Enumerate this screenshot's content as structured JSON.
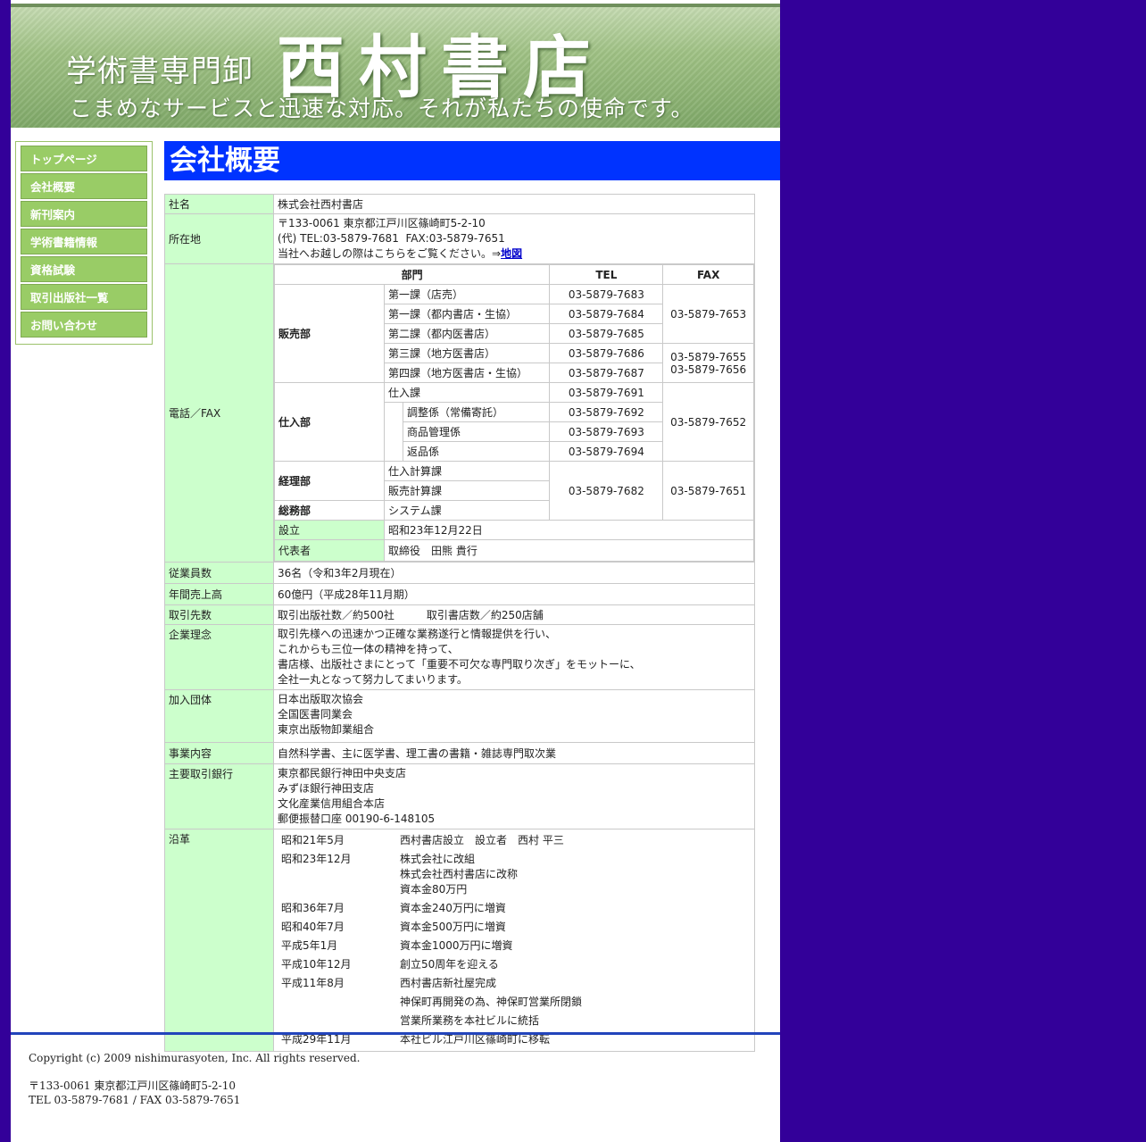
{
  "header": {
    "sub_title": "学術書専門卸",
    "main_title": "西村書店",
    "tagline": "こまめなサービスと迅速な対応。それが私たちの使命です。"
  },
  "nav": {
    "items": [
      "トップページ",
      "会社概要",
      "新刊案内",
      "学術書籍情報",
      "資格試験",
      "取引出版社一覧",
      "お問い合わせ"
    ]
  },
  "page_title": "会社概要",
  "company": {
    "name_label": "社名",
    "name_value": "株式会社西村書店",
    "address_label": "所在地",
    "address_line1": "〒133-0061 東京都江戸川区篠崎町5-2-10",
    "address_line2": "(代) TEL:03-5879-7681  FAX:03-5879-7651",
    "address_line3": "当社へお越しの際はこちらをご覧ください。⇒",
    "map_link": "地図",
    "phone_label": "電話／FAX",
    "phone_headers": [
      "部門",
      "TEL",
      "FAX"
    ],
    "sales_dept": "販売部",
    "sales_rows": [
      {
        "section": "第一課（店売）",
        "tel": "03-5879-7683"
      },
      {
        "section": "第一課（都内書店・生協）",
        "tel": "03-5879-7684"
      },
      {
        "section": "第二課（都内医書店）",
        "tel": "03-5879-7685"
      },
      {
        "section": "第三課（地方医書店）",
        "tel": "03-5879-7686"
      },
      {
        "section": "第四課（地方医書店・生協）",
        "tel": "03-5879-7687"
      }
    ],
    "sales_fax1": "03-5879-7653",
    "sales_fax2a": "03-5879-7655",
    "sales_fax2b": "03-5879-7656",
    "purchase_dept": "仕入部",
    "purchase_section": "仕入課",
    "purchase_tel": "03-5879-7691",
    "purchase_sub": [
      {
        "section": "調整係（常備寄託）",
        "tel": "03-5879-7692"
      },
      {
        "section": "商品管理係",
        "tel": "03-5879-7693"
      },
      {
        "section": "返品係",
        "tel": "03-5879-7694"
      }
    ],
    "purchase_fax": "03-5879-7652",
    "accounting_dept": "経理部",
    "accounting_sections": [
      "仕入計算課",
      "販売計算課"
    ],
    "general_dept": "総務部",
    "general_section": "システム課",
    "accounting_tel": "03-5879-7682",
    "accounting_fax": "03-5879-7651",
    "founded_label": "設立",
    "founded_value": "昭和23年12月22日",
    "rep_label": "代表者",
    "rep_value": "取締役　田熊 貴行",
    "employees_label": "従業員数",
    "employees_value": "36名（令和3年2月現在）",
    "sales_label": "年間売上高",
    "sales_value": "60億円（平成28年11月期）",
    "partners_label": "取引先数",
    "partners_value": "取引出版社数／約500社　　　取引書店数／約250店舗",
    "philosophy_label": "企業理念",
    "philosophy_lines": [
      "取引先様への迅速かつ正確な業務遂行と情報提供を行い、",
      "これからも三位一体の精神を持って、",
      "書店様、出版社さまにとって「重要不可欠な専門取り次ぎ」をモットーに、",
      "全社一丸となって努力してまいります。"
    ],
    "assoc_label": "加入団体",
    "assoc_lines": [
      "日本出版取次協会",
      "全国医書同業会",
      "東京出版物卸業組合"
    ],
    "business_label": "事業内容",
    "business_value": "自然科学書、主に医学書、理工書の書籍・雑誌専門取次業",
    "banks_label": "主要取引銀行",
    "banks_lines": [
      "東京都民銀行神田中央支店",
      "みずほ銀行神田支店",
      "文化産業信用組合本店",
      "郵便振替口座 00190-6-148105"
    ],
    "history_label": "沿革",
    "history": [
      {
        "date": "昭和21年5月",
        "lines": [
          "西村書店設立　設立者　西村 平三"
        ]
      },
      {
        "date": "昭和23年12月",
        "lines": [
          "株式会社に改組",
          "株式会社西村書店に改称",
          "資本金80万円"
        ]
      },
      {
        "date": "昭和36年7月",
        "lines": [
          "資本金240万円に増資"
        ]
      },
      {
        "date": "昭和40年7月",
        "lines": [
          "資本金500万円に増資"
        ]
      },
      {
        "date": "平成5年1月",
        "lines": [
          "資本金1000万円に増資"
        ]
      },
      {
        "date": "平成10年12月",
        "lines": [
          "創立50周年を迎える"
        ]
      },
      {
        "date": "平成11年8月",
        "lines": [
          "西村書店新社屋完成"
        ]
      },
      {
        "date": "",
        "lines": [
          "神保町再開発の為、神保町営業所閉鎖"
        ]
      },
      {
        "date": "",
        "lines": [
          "営業所業務を本社ビルに統括"
        ]
      },
      {
        "date": "平成29年11月",
        "lines": [
          "本社ビル江戸川区篠崎町に移転"
        ]
      }
    ]
  },
  "footer": {
    "copyright": "Copyright (c) 2009 nishimurasyoten, Inc. All rights reserved.",
    "address": "〒133-0061 東京都江戸川区篠崎町5-2-10",
    "phone": "TEL 03-5879-7681 / FAX 03-5879-7651"
  }
}
